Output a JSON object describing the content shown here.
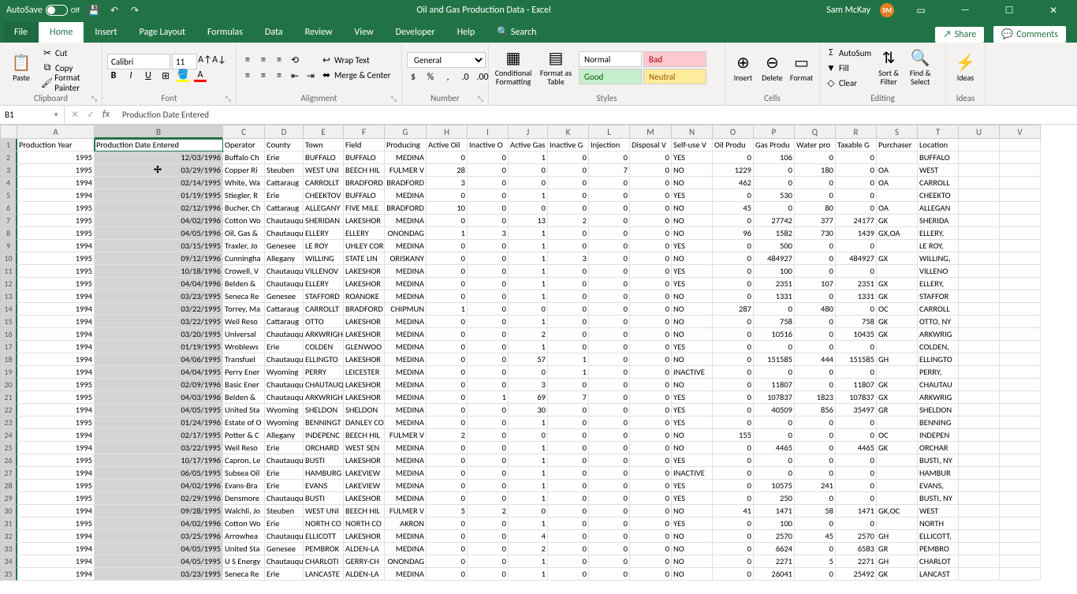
{
  "title": "Oil and Gas Production Data  -  Excel",
  "autosave_label": "AutoSave",
  "autosave_state": "Off",
  "user": {
    "name": "Sam McKay",
    "initials": "SM"
  },
  "tabs": {
    "file": "File",
    "home": "Home",
    "insert": "Insert",
    "page_layout": "Page Layout",
    "formulas": "Formulas",
    "data": "Data",
    "review": "Review",
    "view": "View",
    "developer": "Developer",
    "help": "Help",
    "search": "Search"
  },
  "share_label": "Share",
  "comments_label": "Comments",
  "clipboard": {
    "cut": "Cut",
    "copy": "Copy",
    "format_painter": "Format Painter",
    "paste": "Paste",
    "group": "Clipboard"
  },
  "font": {
    "name": "Calibri",
    "size": "11",
    "group": "Font"
  },
  "alignment": {
    "wrap": "Wrap Text",
    "merge": "Merge & Center",
    "group": "Alignment"
  },
  "number": {
    "format": "General",
    "group": "Number"
  },
  "styles": {
    "cond": "Conditional Formatting",
    "table": "Format as Table",
    "normal": "Normal",
    "bad": "Bad",
    "good": "Good",
    "neutral": "Neutral",
    "group": "Styles"
  },
  "cells": {
    "insert": "Insert",
    "delete": "Delete",
    "format": "Format",
    "group": "Cells"
  },
  "editing": {
    "autosum": "AutoSum",
    "fill": "Fill",
    "clear": "Clear",
    "sort": "Sort & Filter",
    "find": "Find & Select",
    "group": "Editing"
  },
  "ideas": {
    "label": "Ideas",
    "group": "Ideas"
  },
  "namebox": "B1",
  "formula": "Production Date Entered",
  "columns": [
    "A",
    "B",
    "C",
    "D",
    "E",
    "F",
    "G",
    "H",
    "I",
    "J",
    "K",
    "L",
    "M",
    "N",
    "O",
    "P",
    "Q",
    "R",
    "S",
    "T",
    "U",
    "V"
  ],
  "headers": [
    "Production Year",
    "Production Date Entered",
    "Operator",
    "County",
    "Town",
    "Field",
    "Producing",
    "Active Oil",
    "Inactive O",
    "Active Gas",
    "Inactive G",
    "Injection",
    "Disposal V",
    "Self-use V",
    "Oil Produ",
    "Gas Produ",
    "Water pro",
    "Taxable G",
    "Purchaser",
    "Location",
    "",
    ""
  ],
  "numcols": [
    0,
    6,
    7,
    8,
    9,
    10,
    11,
    12,
    14,
    15,
    16,
    17
  ],
  "data": [
    [
      "1995",
      "12/03/1996",
      "Buffalo Ch",
      "Erie",
      "BUFFALO",
      "BUFFALO",
      "MEDINA",
      "0",
      "0",
      "1",
      "0",
      "0",
      "0",
      "YES",
      "0",
      "106",
      "0",
      "0",
      "",
      "BUFFALO",
      "",
      ""
    ],
    [
      "1995",
      "03/29/1996",
      "Copper Ri",
      "Steuben",
      "WEST UNI",
      "BEECH HIL",
      "FULMER V",
      "28",
      "0",
      "0",
      "0",
      "7",
      "0",
      "NO",
      "1229",
      "0",
      "180",
      "0",
      "OA",
      "WEST",
      "",
      ""
    ],
    [
      "1994",
      "02/14/1995",
      "White, Wa",
      "Cattaraug",
      "CARROLLT",
      "BRADFORD",
      "BRADFORD",
      "3",
      "0",
      "0",
      "0",
      "0",
      "0",
      "NO",
      "462",
      "0",
      "0",
      "0",
      "OA",
      "CARROLL",
      "",
      ""
    ],
    [
      "1994",
      "01/19/1995",
      "Stiegler, R",
      "Erie",
      "CHEEKTOV",
      "BUFFALO",
      "MEDINA",
      "0",
      "0",
      "1",
      "0",
      "0",
      "0",
      "YES",
      "0",
      "530",
      "0",
      "0",
      "",
      "CHEEKTO",
      "",
      ""
    ],
    [
      "1995",
      "02/12/1996",
      "Bucher, Ch",
      "Cattaraug",
      "ALLEGANY",
      "FIVE MILE",
      "BRADFORD",
      "10",
      "0",
      "0",
      "0",
      "0",
      "0",
      "NO",
      "45",
      "0",
      "80",
      "0",
      "OA",
      "ALLEGAN",
      "",
      ""
    ],
    [
      "1995",
      "04/02/1996",
      "Cotton Wo",
      "Chautauqu",
      "SHERIDAN",
      "LAKESHOR",
      "MEDINA",
      "0",
      "0",
      "13",
      "2",
      "0",
      "0",
      "NO",
      "0",
      "27742",
      "377",
      "24177",
      "GK",
      "SHERIDA",
      "",
      ""
    ],
    [
      "1995",
      "04/05/1996",
      "Oil, Gas &",
      "Chautauqu",
      "ELLERY",
      "ELLERY",
      "ONONDAG",
      "1",
      "3",
      "1",
      "0",
      "0",
      "0",
      "NO",
      "96",
      "1582",
      "730",
      "1439",
      "GX,OA",
      "ELLERY,",
      "",
      ""
    ],
    [
      "1994",
      "03/15/1995",
      "Traxler, Jo",
      "Genesee",
      "LE ROY",
      "UHLEY COR",
      "MEDINA",
      "0",
      "0",
      "1",
      "0",
      "0",
      "0",
      "YES",
      "0",
      "500",
      "0",
      "0",
      "",
      "LE ROY,",
      "",
      ""
    ],
    [
      "1995",
      "09/12/1996",
      "Cunningha",
      "Allegany",
      "WILLING",
      "STATE LIN",
      "ORISKANY",
      "0",
      "0",
      "1",
      "3",
      "0",
      "0",
      "NO",
      "0",
      "484927",
      "0",
      "484927",
      "GX",
      "WILLING,",
      "",
      ""
    ],
    [
      "1995",
      "10/18/1996",
      "Crowell, V",
      "Chautauqu",
      "VILLENOV",
      "LAKESHOR",
      "MEDINA",
      "0",
      "0",
      "1",
      "0",
      "0",
      "0",
      "YES",
      "0",
      "100",
      "0",
      "0",
      "",
      "VILLENO",
      "",
      ""
    ],
    [
      "1995",
      "04/04/1996",
      "Belden &",
      "Chautauqu",
      "ELLERY",
      "LAKESHOR",
      "MEDINA",
      "0",
      "0",
      "1",
      "0",
      "0",
      "0",
      "YES",
      "0",
      "2351",
      "107",
      "2351",
      "GX",
      "ELLERY,",
      "",
      ""
    ],
    [
      "1994",
      "03/23/1995",
      "Seneca Re",
      "Genesee",
      "STAFFORD",
      "ROANOKE",
      "MEDINA",
      "0",
      "0",
      "1",
      "0",
      "0",
      "0",
      "NO",
      "0",
      "1331",
      "0",
      "1331",
      "GK",
      "STAFFOR",
      "",
      ""
    ],
    [
      "1994",
      "03/22/1995",
      "Torrey, Ma",
      "Cattaraug",
      "CARROLLT",
      "BRADFORD",
      "CHIPMUN",
      "1",
      "0",
      "0",
      "0",
      "0",
      "0",
      "NO",
      "287",
      "0",
      "480",
      "0",
      "OC",
      "CARROLL",
      "",
      ""
    ],
    [
      "1994",
      "03/22/1995",
      "Weil Reso",
      "Cattaraug",
      "OTTO",
      "LAKESHOR",
      "MEDINA",
      "0",
      "0",
      "1",
      "0",
      "0",
      "0",
      "NO",
      "0",
      "758",
      "0",
      "758",
      "GK",
      "OTTO, NY",
      "",
      ""
    ],
    [
      "1994",
      "03/20/1995",
      "Universal",
      "Chautauqu",
      "ARKWRIGH",
      "LAKESHOR",
      "MEDINA",
      "0",
      "0",
      "2",
      "0",
      "0",
      "0",
      "NO",
      "0",
      "10516",
      "0",
      "10435",
      "GK",
      "ARKWRIG",
      "",
      ""
    ],
    [
      "1994",
      "01/19/1995",
      "Wroblews",
      "Erie",
      "COLDEN",
      "GLENWOO",
      "MEDINA",
      "0",
      "0",
      "1",
      "0",
      "0",
      "0",
      "YES",
      "0",
      "0",
      "0",
      "0",
      "",
      "COLDEN,",
      "",
      ""
    ],
    [
      "1994",
      "04/06/1995",
      "Transfuel",
      "Chautauqu",
      "ELLINGTO",
      "LAKESHOR",
      "MEDINA",
      "0",
      "0",
      "57",
      "1",
      "0",
      "0",
      "NO",
      "0",
      "151585",
      "444",
      "151585",
      "GH",
      "ELLINGTO",
      "",
      ""
    ],
    [
      "1994",
      "04/04/1995",
      "Perry Ener",
      "Wyoming",
      "PERRY",
      "LEICESTER",
      "MEDINA",
      "0",
      "0",
      "0",
      "1",
      "0",
      "0",
      "INACTIVE",
      "0",
      "0",
      "0",
      "0",
      "",
      "PERRY,",
      "",
      ""
    ],
    [
      "1995",
      "02/09/1996",
      "Basic Ener",
      "Chautauqu",
      "CHAUTAUQ",
      "LAKESHOR",
      "MEDINA",
      "0",
      "0",
      "3",
      "0",
      "0",
      "0",
      "NO",
      "0",
      "11807",
      "0",
      "11807",
      "GK",
      "CHAUTAU",
      "",
      ""
    ],
    [
      "1995",
      "04/03/1996",
      "Belden &",
      "Chautauqu",
      "ARKWRIGH",
      "LAKESHOR",
      "MEDINA",
      "0",
      "1",
      "69",
      "7",
      "0",
      "0",
      "YES",
      "0",
      "107837",
      "1823",
      "107837",
      "GX",
      "ARKWRIG",
      "",
      ""
    ],
    [
      "1994",
      "04/05/1995",
      "United Sta",
      "Wyoming",
      "SHELDON",
      "SHELDON",
      "MEDINA",
      "0",
      "0",
      "30",
      "0",
      "0",
      "0",
      "YES",
      "0",
      "40509",
      "856",
      "35497",
      "GR",
      "SHELDON",
      "",
      ""
    ],
    [
      "1995",
      "01/24/1996",
      "Estate of O",
      "Wyoming",
      "BENNINGT",
      "DANLEY CO",
      "MEDINA",
      "0",
      "0",
      "1",
      "0",
      "0",
      "0",
      "YES",
      "0",
      "0",
      "0",
      "0",
      "",
      "BENNING",
      "",
      ""
    ],
    [
      "1994",
      "02/17/1995",
      "Potter & C",
      "Allegany",
      "INDEPENC",
      "BEECH HIL",
      "FULMER V",
      "2",
      "0",
      "0",
      "0",
      "0",
      "0",
      "NO",
      "155",
      "0",
      "0",
      "0",
      "OC",
      "INDEPEN",
      "",
      ""
    ],
    [
      "1994",
      "03/22/1995",
      "Weil Reso",
      "Erie",
      "ORCHARD",
      "WEST SEN",
      "MEDINA",
      "0",
      "0",
      "1",
      "0",
      "0",
      "0",
      "NO",
      "0",
      "4465",
      "0",
      "4465",
      "GK",
      "ORCHAR",
      "",
      ""
    ],
    [
      "1995",
      "10/17/1996",
      "Capron, Le",
      "Chautauqu",
      "BUSTI",
      "LAKESHOR",
      "MEDINA",
      "0",
      "0",
      "1",
      "0",
      "0",
      "0",
      "YES",
      "0",
      "0",
      "0",
      "0",
      "",
      "BUSTI, NY",
      "",
      ""
    ],
    [
      "1994",
      "06/05/1995",
      "Subsea Oil",
      "Erie",
      "HAMBURG",
      "LAKEVIEW",
      "MEDINA",
      "0",
      "0",
      "1",
      "0",
      "0",
      "0",
      "INACTIVE",
      "0",
      "0",
      "0",
      "0",
      "",
      "HAMBUR",
      "",
      ""
    ],
    [
      "1995",
      "04/02/1996",
      "Evans-Bra",
      "Erie",
      "EVANS",
      "LAKEVIEW",
      "MEDINA",
      "0",
      "0",
      "1",
      "0",
      "0",
      "0",
      "YES",
      "0",
      "10575",
      "241",
      "0",
      "",
      "EVANS,",
      "",
      ""
    ],
    [
      "1995",
      "02/29/1996",
      "Densmore",
      "Chautauqu",
      "BUSTI",
      "LAKESHOR",
      "MEDINA",
      "0",
      "0",
      "1",
      "0",
      "0",
      "0",
      "YES",
      "0",
      "250",
      "0",
      "0",
      "",
      "BUSTI, NY",
      "",
      ""
    ],
    [
      "1994",
      "09/28/1995",
      "Walchli, Jo",
      "Steuben",
      "WEST UNI",
      "BEECH HIL",
      "FULMER V",
      "5",
      "2",
      "0",
      "0",
      "0",
      "0",
      "NO",
      "41",
      "1471",
      "58",
      "1471",
      "GK,OC",
      "WEST",
      "",
      ""
    ],
    [
      "1995",
      "04/02/1996",
      "Cotton Wo",
      "Erie",
      "NORTH CO",
      "NORTH CO",
      "AKRON",
      "0",
      "0",
      "1",
      "0",
      "0",
      "0",
      "YES",
      "0",
      "100",
      "0",
      "0",
      "",
      "NORTH",
      "",
      ""
    ],
    [
      "1994",
      "03/25/1996",
      "Arrowhea",
      "Chautauqu",
      "ELLICOTT",
      "LAKESHOR",
      "MEDINA",
      "0",
      "0",
      "4",
      "0",
      "0",
      "0",
      "NO",
      "0",
      "2570",
      "45",
      "2570",
      "GH",
      "ELLICOTT,",
      "",
      ""
    ],
    [
      "1994",
      "04/05/1995",
      "United Sta",
      "Genesee",
      "PEMBROK",
      "ALDEN-LA",
      "MEDINA",
      "0",
      "0",
      "2",
      "0",
      "0",
      "0",
      "NO",
      "0",
      "6624",
      "0",
      "6583",
      "GR",
      "PEMBRO",
      "",
      ""
    ],
    [
      "1994",
      "04/05/1995",
      "U S Energy",
      "Chautauqu",
      "CHARLOTI",
      "GERRY-CH",
      "ONONDAG",
      "0",
      "0",
      "1",
      "0",
      "0",
      "0",
      "NO",
      "0",
      "2271",
      "5",
      "2271",
      "GH",
      "CHARLOT",
      "",
      ""
    ],
    [
      "1994",
      "03/23/1995",
      "Seneca Re",
      "Erie",
      "LANCASTE",
      "ALDEN-LA",
      "MEDINA",
      "0",
      "0",
      "1",
      "0",
      "0",
      "0",
      "NO",
      "0",
      "26041",
      "0",
      "25492",
      "GK",
      "LANCAST",
      "",
      ""
    ]
  ]
}
